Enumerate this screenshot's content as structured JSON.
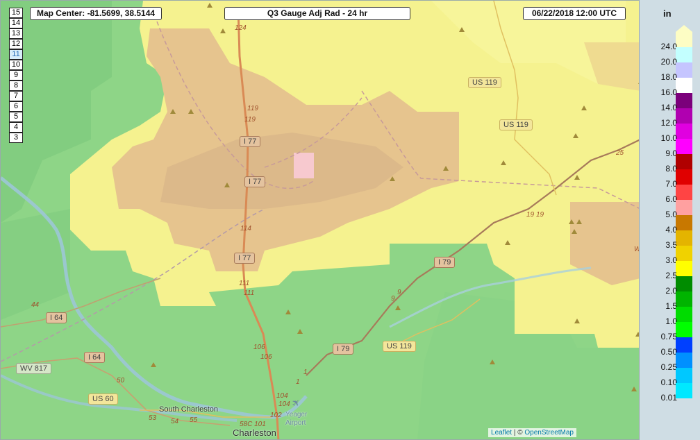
{
  "header": {
    "map_center": "Map Center: -81.5699, 38.5144",
    "product_title": "Q3 Gauge Adj Rad - 24 hr",
    "timestamp": "06/22/2018  12:00 UTC"
  },
  "zoom_levels": [
    "15",
    "14",
    "13",
    "12",
    "11",
    "10",
    "9",
    "8",
    "7",
    "6",
    "5",
    "4",
    "3"
  ],
  "zoom_active": "11",
  "legend": {
    "unit": "in",
    "entries": [
      {
        "label": "24.0",
        "color": "#fdfdc4"
      },
      {
        "label": "20.0",
        "color": "#c3ffff"
      },
      {
        "label": "18.0",
        "color": "#c5c5ff"
      },
      {
        "label": "16.0",
        "color": "#ffffff"
      },
      {
        "label": "14.0",
        "color": "#7b007b"
      },
      {
        "label": "12.0",
        "color": "#b000b0"
      },
      {
        "label": "10.0",
        "color": "#e000e0"
      },
      {
        "label": "9.0",
        "color": "#ff00ff"
      },
      {
        "label": "8.0",
        "color": "#b00000"
      },
      {
        "label": "7.0",
        "color": "#e00000"
      },
      {
        "label": "6.0",
        "color": "#ff4444"
      },
      {
        "label": "5.0",
        "color": "#ffa0a0"
      },
      {
        "label": "4.0",
        "color": "#c87800"
      },
      {
        "label": "3.5",
        "color": "#e4b400"
      },
      {
        "label": "3.0",
        "color": "#f0d200"
      },
      {
        "label": "2.5",
        "color": "#ffff00"
      },
      {
        "label": "2.0",
        "color": "#008c00"
      },
      {
        "label": "1.5",
        "color": "#00b400"
      },
      {
        "label": "1.0",
        "color": "#00dc00"
      },
      {
        "label": "0.75",
        "color": "#00ff00"
      },
      {
        "label": "0.50",
        "color": "#0040ff"
      },
      {
        "label": "0.25",
        "color": "#0090ff"
      },
      {
        "label": "0.10",
        "color": "#00c8ff"
      },
      {
        "label": "0.01",
        "color": "#00e8ff"
      }
    ]
  },
  "map_labels": {
    "routes": [
      "I 77",
      "I 77",
      "I 77",
      "I 79",
      "I 79",
      "I 64",
      "I 64",
      "US 119",
      "US 119",
      "US 119",
      "US 60",
      "WV 817"
    ],
    "places": [
      "South Charleston",
      "Charleston",
      "Yeager",
      "Airport"
    ],
    "road_numbers": [
      "124",
      "119",
      "119",
      "114",
      "111",
      "111",
      "106",
      "106",
      "104",
      "104",
      "102",
      "58C 101",
      "55",
      "54",
      "53",
      "50",
      "44",
      "9",
      "9",
      "1",
      "1",
      "19",
      "19",
      "25",
      "W"
    ]
  },
  "attribution": {
    "leaflet": "Leaflet",
    "separator": " | © ",
    "osm": "OpenStreetMap"
  },
  "colors": {
    "precip_low": "#8ed587",
    "precip_mid": "#f5f28f",
    "precip_high": "#e6c48e",
    "precip_peak": "#f7c9cf",
    "road": "#c8734a"
  }
}
